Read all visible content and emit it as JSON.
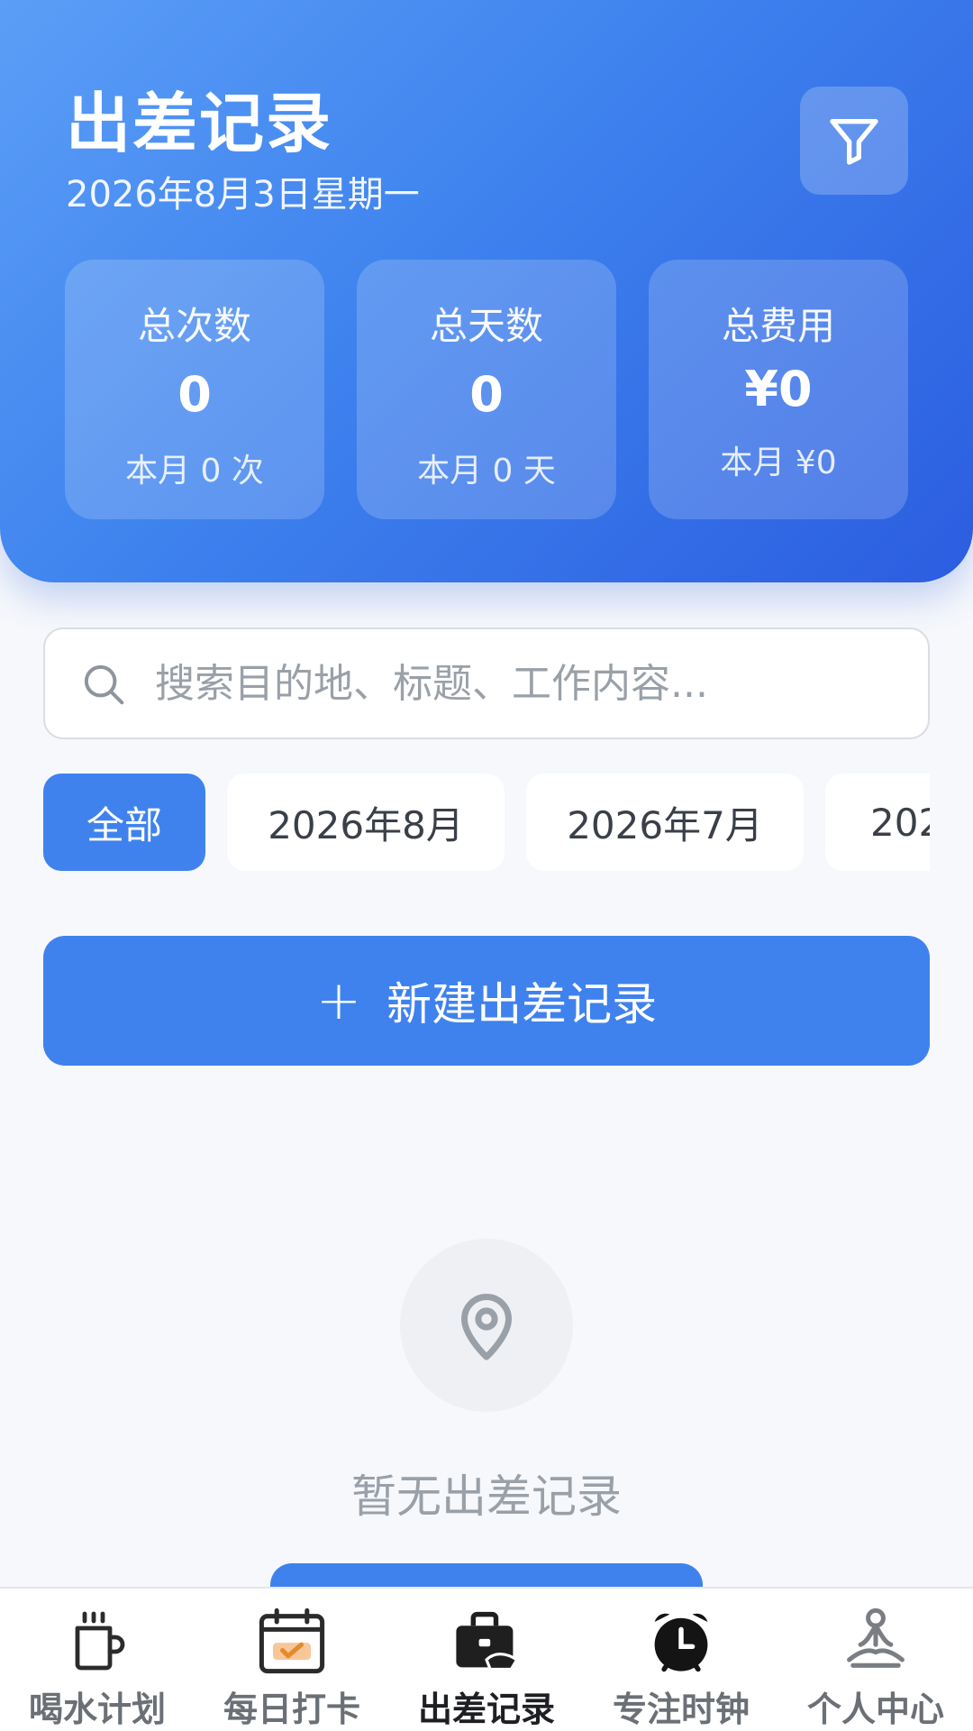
{
  "header": {
    "title": "出差记录",
    "date": "2026年8月3日星期一",
    "filter_icon": "filter-icon",
    "stats": [
      {
        "label": "总次数",
        "value": "0",
        "sub": "本月 0 次"
      },
      {
        "label": "总天数",
        "value": "0",
        "sub": "本月 0 天"
      },
      {
        "label": "总费用",
        "value": "¥0",
        "sub": "本月 ¥0"
      }
    ]
  },
  "search": {
    "placeholder": "搜索目的地、标题、工作内容...",
    "value": ""
  },
  "filters": [
    "全部",
    "2026年8月",
    "2026年7月",
    "202"
  ],
  "actions": {
    "new_label": "新建出差记录",
    "plus_icon": "+"
  },
  "empty": {
    "icon": "location-pin-icon",
    "text": "暂无出差记录"
  },
  "tabs": [
    {
      "label": "喝水计划",
      "icon": "cup-icon"
    },
    {
      "label": "每日打卡",
      "icon": "calendar-check-icon"
    },
    {
      "label": "出差记录",
      "icon": "briefcase-icon",
      "active": true
    },
    {
      "label": "专注时钟",
      "icon": "alarm-clock-icon"
    },
    {
      "label": "个人中心",
      "icon": "meditation-person-icon"
    }
  ],
  "colors": {
    "accent": "#3f82ee",
    "header_start": "#5b9ef7",
    "header_end": "#2b5de0"
  }
}
